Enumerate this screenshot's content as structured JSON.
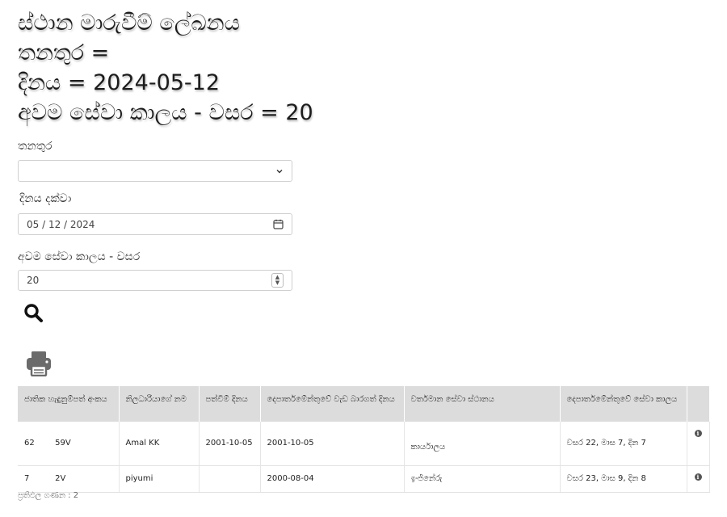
{
  "header": {
    "title": "ස්ථාන මාරුවීම් ලේඛනය",
    "designation_line": "තනතුර =",
    "date_line": "දිනය = 2024-05-12",
    "min_service_line": "අවම සේවා කාලය - වසර = 20"
  },
  "form": {
    "designation_label": "තනතුර",
    "designation_value": "",
    "date_label": "දිනය දක්වා",
    "date_value": "05 / 12 / 2024",
    "min_service_label": "අවම සේවා කාලය - වසර",
    "min_service_value": "20"
  },
  "icons": {
    "search": "search-icon",
    "print": "print-icon",
    "info": "info-icon",
    "calendar": "calendar-icon"
  },
  "table": {
    "headers": [
      "ජාතික හැඳුනුම්පත් අංකය",
      "නිලධාරියාගේ නම",
      "පත්වීම් දිනය",
      "දෙපාර්තමේන්තුවේ වැඩ බාරගත් දිනය",
      "වර්තමාන සේවා ස්ථානය",
      "දෙපාර්තමේන්තුවේ සේවා කාලය",
      ""
    ],
    "rows": [
      {
        "nic": "62        59V",
        "name": "Amal KK",
        "appointment": "2001-10-05",
        "assumed": "2001-10-05",
        "station": "කාර්යාලය",
        "service": "වසර 22, මාස 7, දින 7"
      },
      {
        "nic": "7          2V",
        "name": "piyumi",
        "appointment": "",
        "assumed": "2000-08-04",
        "station": "ඉංජිනේරු",
        "service": "වසර 23, මාස 9, දින 8"
      }
    ]
  },
  "footer": {
    "result_count": "ප්‍රතිඵල ගණන : 2"
  }
}
